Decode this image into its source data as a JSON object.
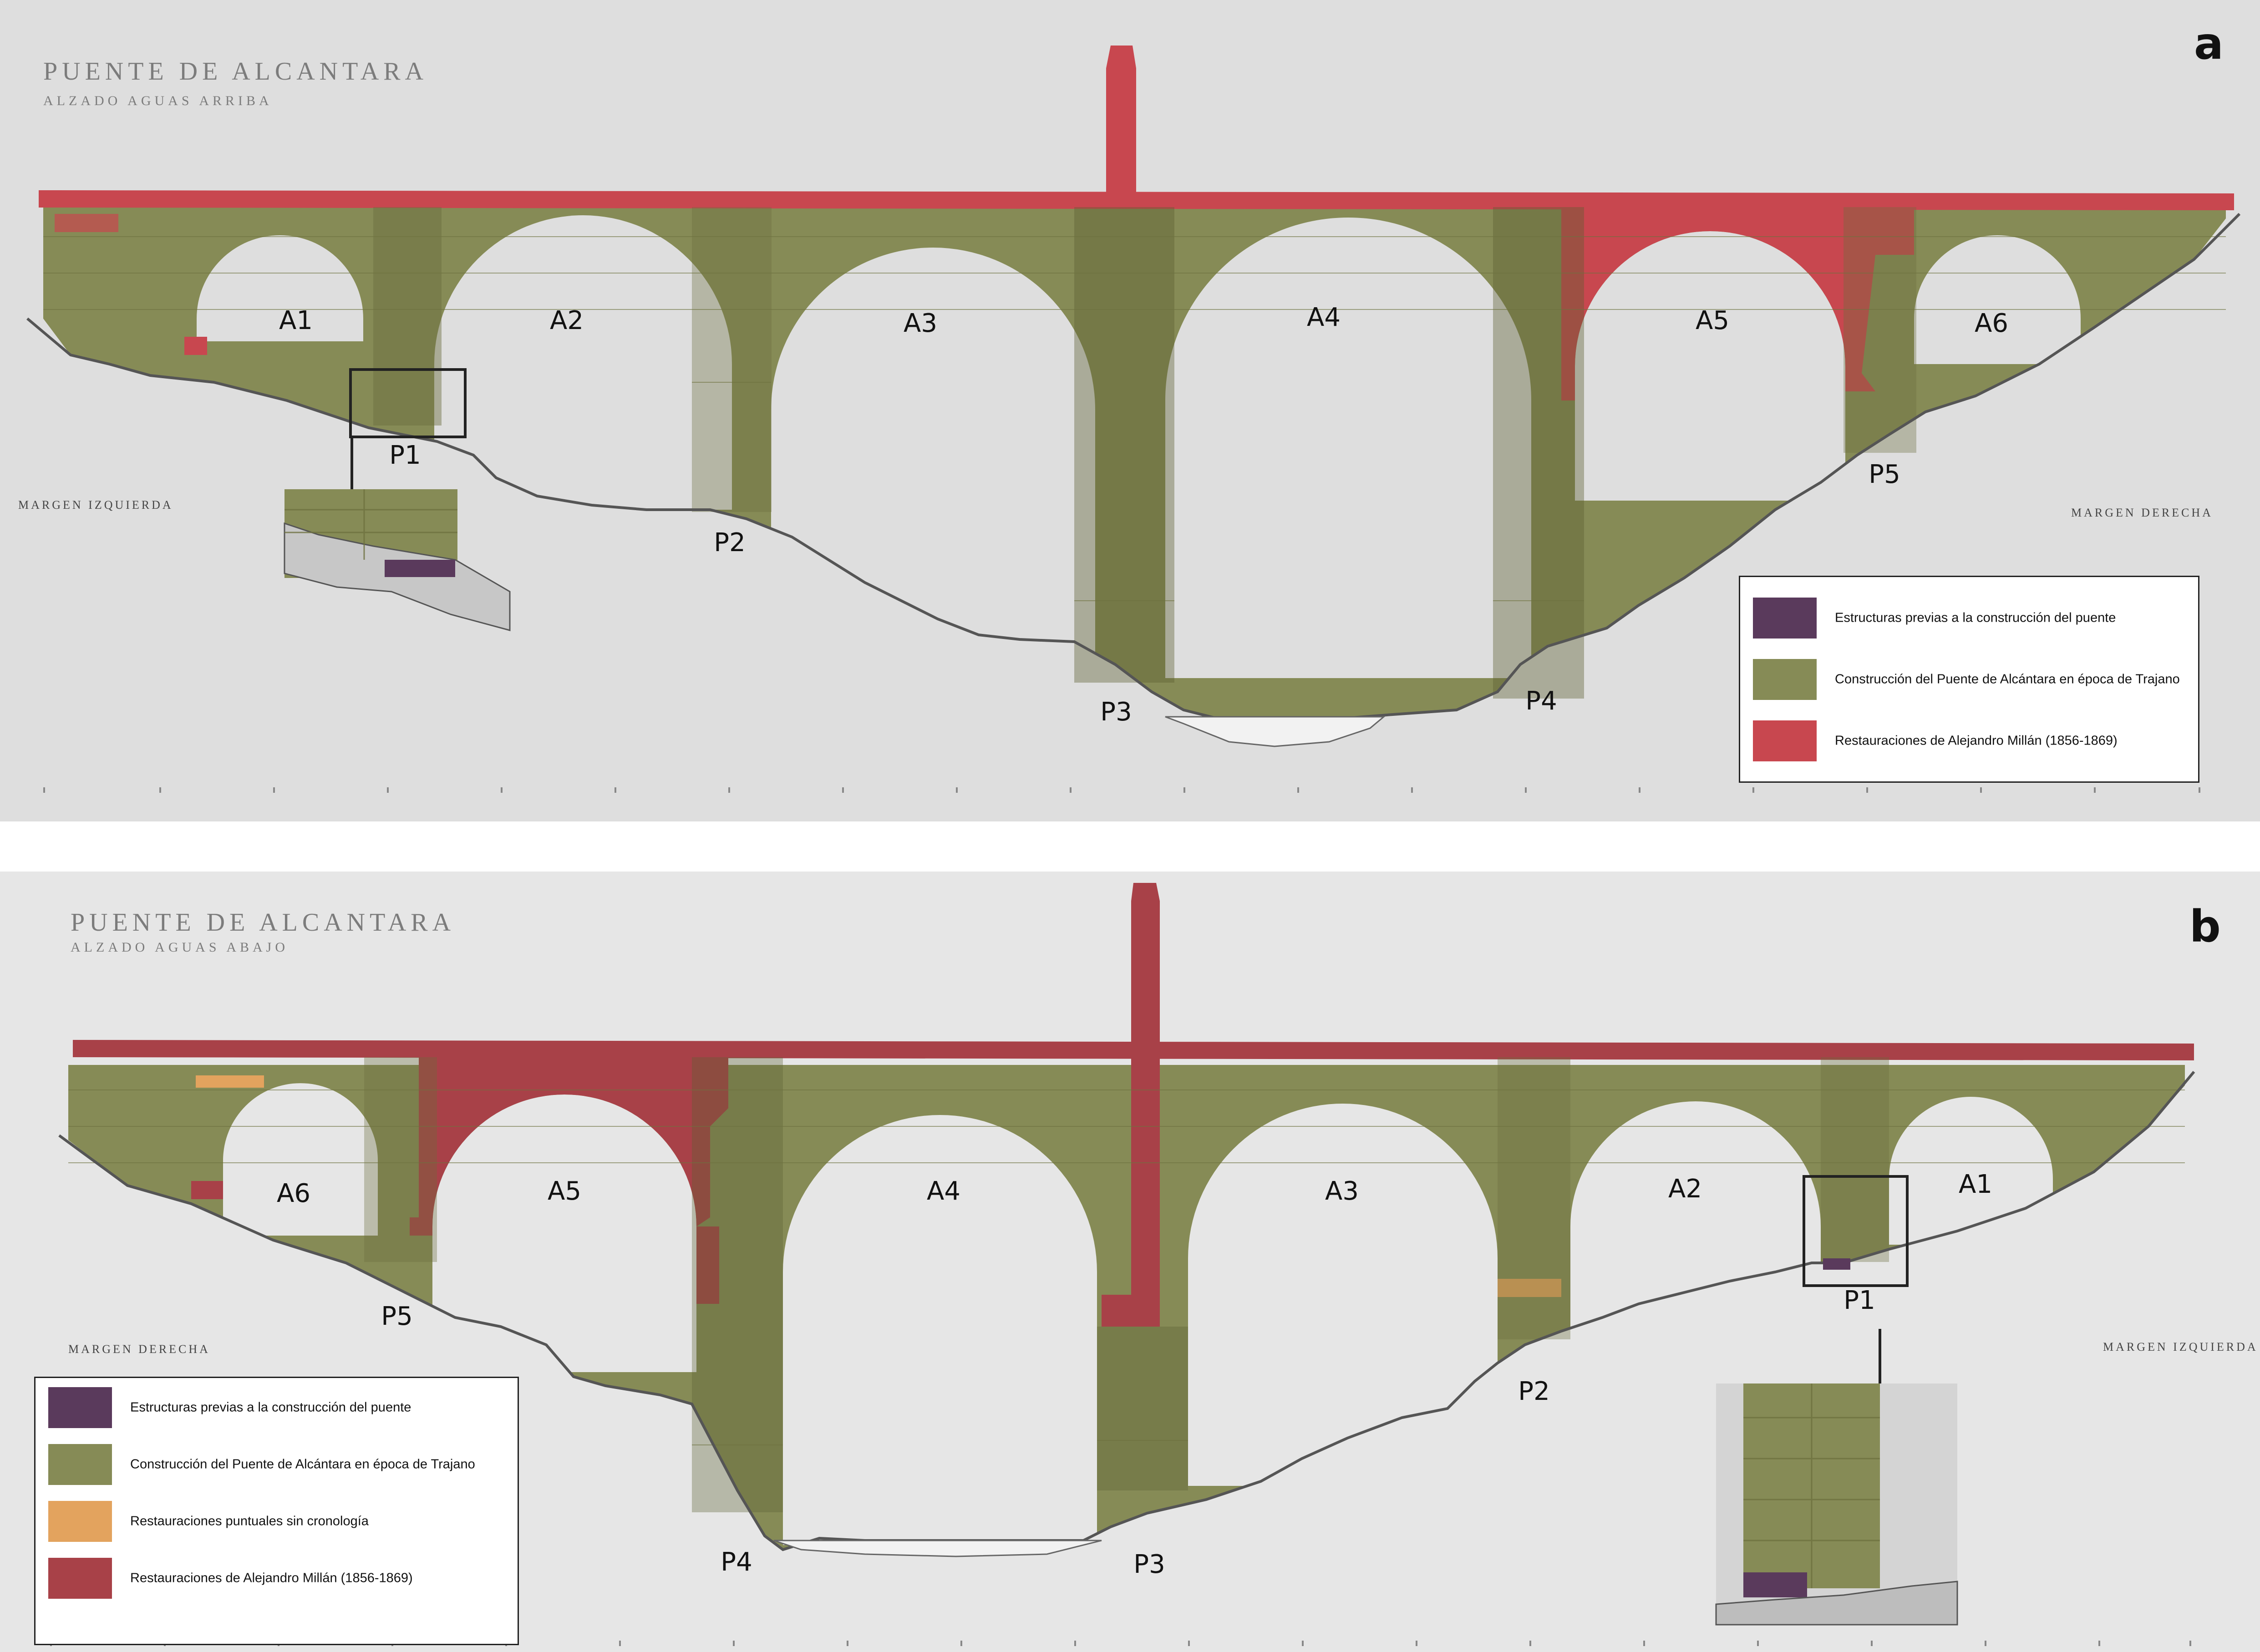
{
  "colors": {
    "previas": "#5a3a5c",
    "trajano": "#868b56",
    "puntuales": "#e3a35e",
    "millan_a": "#c8474f",
    "millan_b": "#a84148"
  },
  "panel_a": {
    "letter": "a",
    "title": "PUENTE DE ALCANTARA",
    "subtitle": "ALZADO AGUAS ARRIBA",
    "margin_left": "MARGEN IZQUIERDA",
    "margin_right": "MARGEN DERECHA",
    "arches": [
      "A1",
      "A2",
      "A3",
      "A4",
      "A5",
      "A6"
    ],
    "piers": [
      "P1",
      "P2",
      "P3",
      "P4",
      "P5"
    ],
    "legend": [
      {
        "text": "Estructuras previas a la construcción del puente",
        "color": "#5a3a5c"
      },
      {
        "text": "Construcción del Puente de Alcántara en época de Trajano",
        "color": "#868b56"
      },
      {
        "text": "Restauraciones de Alejandro Millán (1856-1869)",
        "color": "#c8474f"
      }
    ]
  },
  "panel_b": {
    "letter": "b",
    "title": "PUENTE DE ALCANTARA",
    "subtitle": "ALZADO AGUAS ABAJO",
    "margin_left": "MARGEN DERECHA",
    "margin_right": "MARGEN IZQUIERDA",
    "arches": [
      "A6",
      "A5",
      "A4",
      "A3",
      "A2",
      "A1"
    ],
    "piers": [
      "P5",
      "P4",
      "P3",
      "P2",
      "P1"
    ],
    "legend": [
      {
        "text": "Estructuras previas a la construcción del puente",
        "color": "#5a3a5c"
      },
      {
        "text": "Construcción del Puente de Alcántara en época de Trajano",
        "color": "#868b56"
      },
      {
        "text": "Restauraciones puntuales sin cronología",
        "color": "#e3a35e"
      },
      {
        "text": "Restauraciones de Alejandro Millán (1856-1869)",
        "color": "#a84148"
      }
    ]
  }
}
